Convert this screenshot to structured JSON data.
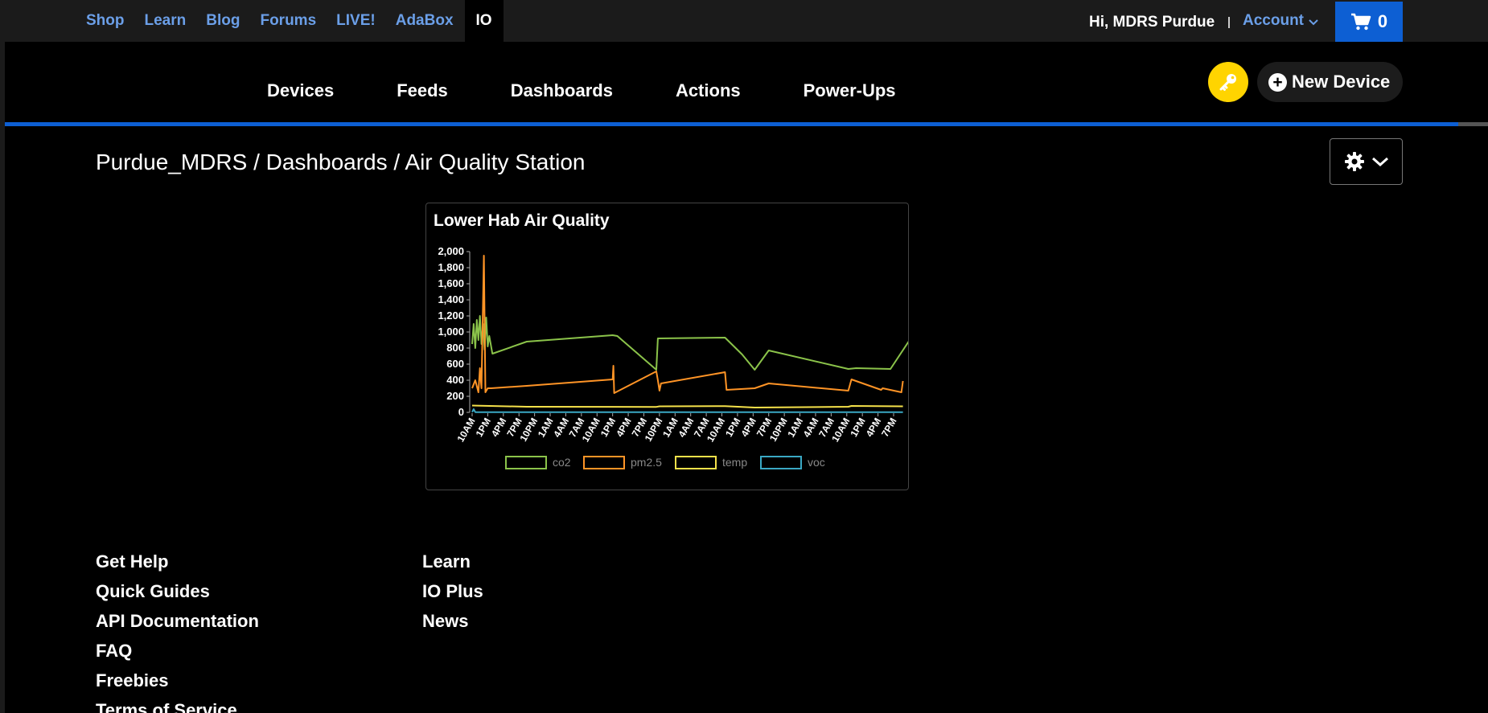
{
  "topnav": {
    "items": [
      "Shop",
      "Learn",
      "Blog",
      "Forums",
      "LIVE!",
      "AdaBox"
    ],
    "active": "IO"
  },
  "header": {
    "greeting": "Hi, MDRS Purdue",
    "account_label": "Account",
    "cart_count": "0"
  },
  "subnav": {
    "items": [
      "Devices",
      "Feeds",
      "Dashboards",
      "Actions",
      "Power-Ups"
    ],
    "new_device_label": "New Device"
  },
  "breadcrumb": "Purdue_MDRS / Dashboards / Air Quality Station",
  "colors": {
    "accent_blue": "#0d5fd3",
    "link_blue": "#6b9fe8",
    "key_yellow": "#ffd400",
    "co2": "#8bc34a",
    "pm25": "#ff9426",
    "temp": "#f5e14a",
    "voc": "#3aa8c4"
  },
  "chart_data": {
    "type": "line",
    "title": "Lower Hab Air Quality",
    "ylim": [
      0,
      2000
    ],
    "yticks": [
      "0",
      "200",
      "400",
      "600",
      "800",
      "1,000",
      "1,200",
      "1,400",
      "1,600",
      "1,800",
      "2,000"
    ],
    "xticks": [
      "10AM",
      "1PM",
      "4PM",
      "7PM",
      "10PM",
      "1AM",
      "4AM",
      "7AM",
      "10AM",
      "1PM",
      "4PM",
      "7PM",
      "10PM",
      "1AM",
      "4AM",
      "7AM",
      "10AM",
      "1PM",
      "4PM",
      "7PM",
      "10PM",
      "1AM",
      "4AM",
      "7AM",
      "10AM",
      "1PM",
      "4PM",
      "7PM"
    ],
    "grid": false,
    "legend_position": "bottom",
    "series": [
      {
        "name": "co2",
        "points": [
          [
            0,
            850
          ],
          [
            0.1,
            1100
          ],
          [
            0.2,
            800
          ],
          [
            0.3,
            1150
          ],
          [
            0.4,
            900
          ],
          [
            0.5,
            1200
          ],
          [
            0.6,
            850
          ],
          [
            0.7,
            1100
          ],
          [
            0.8,
            780
          ],
          [
            0.9,
            1180
          ],
          [
            1.0,
            820
          ],
          [
            1.1,
            950
          ],
          [
            1.3,
            730
          ],
          [
            3.5,
            880
          ],
          [
            9.0,
            960
          ],
          [
            9.3,
            950
          ],
          [
            11.8,
            530
          ],
          [
            11.9,
            920
          ],
          [
            16.2,
            930
          ],
          [
            17.3,
            720
          ],
          [
            18.1,
            530
          ],
          [
            19.0,
            770
          ],
          [
            24.1,
            540
          ],
          [
            24.6,
            550
          ],
          [
            26.8,
            540
          ],
          [
            28.1,
            920
          ],
          [
            28.3,
            700
          ],
          [
            28.7,
            540
          ]
        ]
      },
      {
        "name": "pm2.5",
        "points": [
          [
            0,
            300
          ],
          [
            0.2,
            400
          ],
          [
            0.4,
            250
          ],
          [
            0.5,
            550
          ],
          [
            0.6,
            300
          ],
          [
            0.75,
            1950
          ],
          [
            0.85,
            250
          ],
          [
            1.0,
            300
          ],
          [
            1.2,
            300
          ],
          [
            3.5,
            330
          ],
          [
            9.0,
            410
          ],
          [
            9.05,
            580
          ],
          [
            9.1,
            240
          ],
          [
            11.8,
            510
          ],
          [
            11.9,
            400
          ],
          [
            12.0,
            270
          ],
          [
            12.1,
            360
          ],
          [
            16.2,
            500
          ],
          [
            16.3,
            280
          ],
          [
            18.1,
            300
          ],
          [
            19.0,
            360
          ],
          [
            24.1,
            270
          ],
          [
            24.3,
            410
          ],
          [
            26.2,
            280
          ],
          [
            26.3,
            300
          ],
          [
            27.5,
            250
          ],
          [
            27.6,
            390
          ]
        ]
      },
      {
        "name": "temp",
        "points": [
          [
            0,
            85
          ],
          [
            3.5,
            70
          ],
          [
            11.8,
            68
          ],
          [
            12.0,
            75
          ],
          [
            16.2,
            78
          ],
          [
            18.1,
            60
          ],
          [
            24.1,
            70
          ],
          [
            24.3,
            80
          ],
          [
            27.6,
            75
          ]
        ]
      },
      {
        "name": "voc",
        "points": [
          [
            0,
            3
          ],
          [
            0.1,
            40
          ],
          [
            0.2,
            3
          ],
          [
            27.6,
            3
          ]
        ]
      }
    ]
  },
  "footer": {
    "col1": [
      "Get Help",
      "Quick Guides",
      "API Documentation",
      "FAQ",
      "Freebies",
      "Terms of Service"
    ],
    "col2": [
      "Learn",
      "IO Plus",
      "News"
    ]
  }
}
